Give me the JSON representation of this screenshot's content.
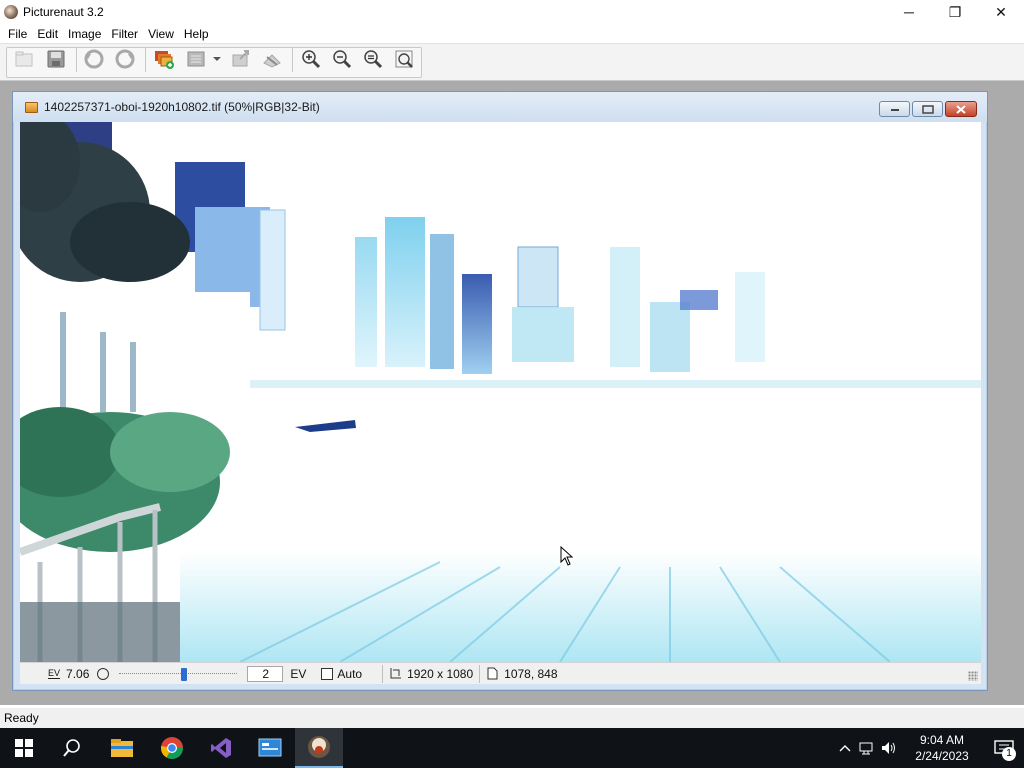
{
  "app": {
    "title": "Picturenaut 3.2",
    "window_controls": {
      "minimize": "─",
      "restore": "❐",
      "close": "✕"
    }
  },
  "menu": {
    "items": [
      {
        "label": "File"
      },
      {
        "label": "Edit"
      },
      {
        "label": "Image"
      },
      {
        "label": "Filter"
      },
      {
        "label": "View"
      },
      {
        "label": "Help"
      }
    ]
  },
  "toolbar": {
    "buttons": [
      {
        "name": "open-icon"
      },
      {
        "name": "save-icon"
      },
      {
        "name": "undo-icon"
      },
      {
        "name": "redo-icon"
      },
      {
        "name": "generate-hdr-icon"
      },
      {
        "name": "batch-icon"
      },
      {
        "name": "tonemap-icon"
      },
      {
        "name": "align-icon"
      },
      {
        "name": "zoom-in-icon"
      },
      {
        "name": "zoom-out-icon"
      },
      {
        "name": "zoom-fit-icon"
      },
      {
        "name": "zoom-actual-icon"
      }
    ]
  },
  "document": {
    "title": "1402257371-oboi-1920h10802.tif (50%|RGB|32-Bit)",
    "status": {
      "ev_label": "EV",
      "ev_value": "7.06",
      "exposure_value": "2",
      "exposure_slider_position": 0.55,
      "exposure_unit": "EV",
      "auto_label": "Auto",
      "auto_checked": false,
      "image_size": "1920 x 1080",
      "cursor_position": "1078, 848"
    }
  },
  "statusbar": {
    "text": "Ready"
  },
  "taskbar": {
    "apps": [
      {
        "name": "start-icon"
      },
      {
        "name": "search-icon"
      },
      {
        "name": "file-explorer-icon"
      },
      {
        "name": "chrome-icon"
      },
      {
        "name": "visual-studio-icon"
      },
      {
        "name": "control-panel-icon"
      },
      {
        "name": "picturenaut-icon",
        "active": true
      }
    ],
    "clock": {
      "time": "9:04 AM",
      "date": "2/24/2023"
    },
    "notifications": "1"
  },
  "colors": {
    "taskbar": "#0f1217",
    "mdi_background": "#ababab",
    "child_title": "#d4e3f3",
    "accent": "#2d6dcd"
  }
}
